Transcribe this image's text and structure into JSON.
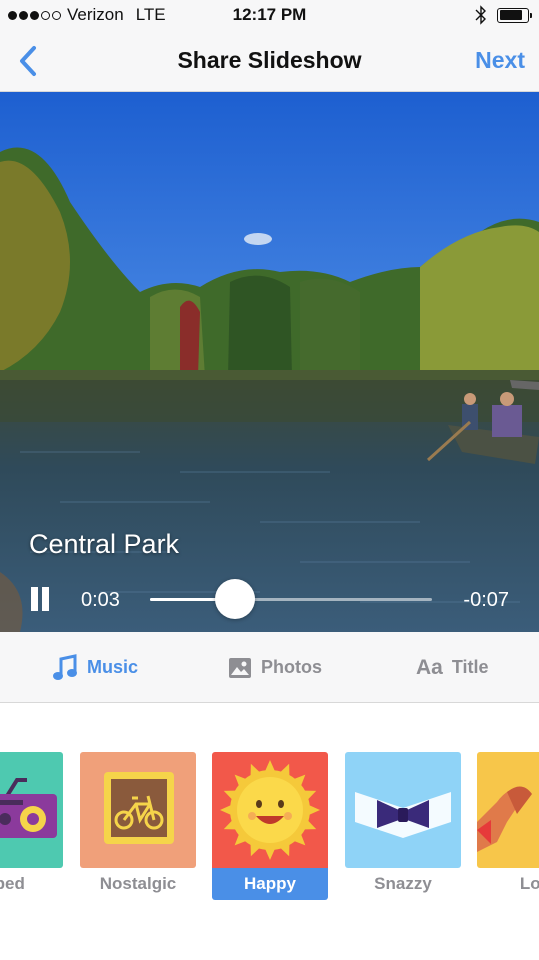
{
  "status_bar": {
    "carrier": "Verizon",
    "network": "LTE",
    "time": "12:17 PM",
    "signal_bars_filled": 3,
    "signal_bars_total": 5,
    "battery_level": 0.85
  },
  "nav": {
    "back_icon": "chevron-left-icon",
    "title": "Share Slideshow",
    "next_label": "Next"
  },
  "player": {
    "photo_title": "Central Park",
    "elapsed": "0:03",
    "remaining": "-0:07",
    "progress": 0.3
  },
  "tabs": [
    {
      "label": "Music",
      "icon": "music-note-icon",
      "selected": true
    },
    {
      "label": "Photos",
      "icon": "photo-icon",
      "selected": false
    },
    {
      "label": "Title",
      "icon": "text-aa-icon",
      "glyph": "Aa",
      "selected": false
    }
  ],
  "themes": [
    {
      "label": "aped",
      "icon": "boombox-icon",
      "color": "#4ec9b0",
      "selected": false
    },
    {
      "label": "Nostalgic",
      "icon": "framed-bicycle-icon",
      "color": "#f0a07a",
      "selected": false
    },
    {
      "label": "Happy",
      "icon": "smiling-sun-icon",
      "color": "#f2584a",
      "selected": true
    },
    {
      "label": "Snazzy",
      "icon": "bow-tie-icon",
      "color": "#8fd3f7",
      "selected": false
    },
    {
      "label": "Lov",
      "icon": "heart-hands-icon",
      "color": "#f7c64a",
      "selected": false
    }
  ],
  "colors": {
    "accent": "#4a8fe7",
    "inactive": "#8e8e93"
  }
}
